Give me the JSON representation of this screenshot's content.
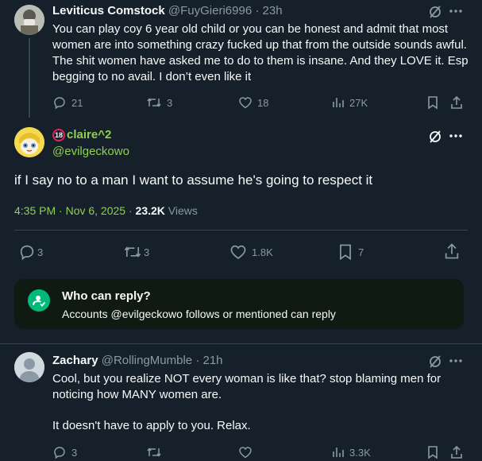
{
  "tweet1": {
    "name": "Leviticus Comstock",
    "handle": "@FuyGieri6996",
    "time": "23h",
    "text": "You can play coy 6 year old child or you can be honest and admit that most women are into something crazy fucked up that from the outside sounds awful. The shit women have asked me to do to them is insane. And they LOVE it. Esp begging to no avail. I don’t even like it",
    "replies": "21",
    "retweets": "3",
    "likes": "18",
    "views": "27K"
  },
  "main": {
    "badge": "18",
    "name": "claire^2",
    "handle": "@evilgeckowo",
    "text": "if I say no to a man I want to assume he's going to respect it",
    "timestamp": "4:35 PM · Nov 6, 2025",
    "view_count": "23.2K",
    "views_label": "Views",
    "replies": "3",
    "retweets": "3",
    "likes": "1.8K",
    "bookmarks": "7",
    "name_color": "#8ed04f"
  },
  "reply_box": {
    "title": "Who can reply?",
    "desc": "Accounts @evilgeckowo follows or mentioned can reply"
  },
  "tweet2": {
    "name": "Zachary",
    "handle": "@RollingMumble",
    "time": "21h",
    "line1": "Cool, but you realize NOT every woman is like that? stop blaming men for noticing how MANY women are.",
    "line2": "It doesn't have to apply to you. Relax.",
    "replies": "3",
    "views": "3.3K"
  },
  "icons": [
    "grok-icon",
    "more-icon",
    "reply-icon",
    "retweet-icon",
    "like-icon",
    "views-icon",
    "bookmark-icon",
    "share-icon",
    "mention-icon"
  ]
}
